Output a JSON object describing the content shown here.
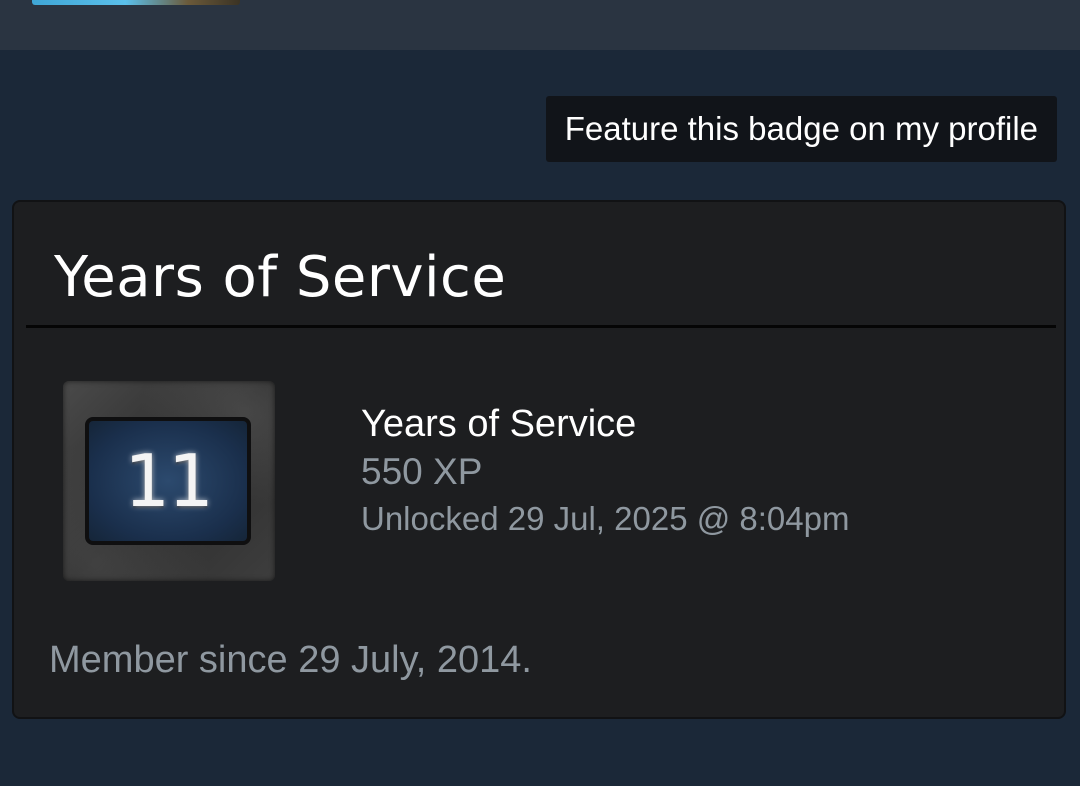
{
  "header": {
    "logo_icon": "steam-level-badge-graphic"
  },
  "actions": {
    "feature_badge_label": "Feature this badge on my profile"
  },
  "badge_panel": {
    "title": "Years of Service",
    "badge": {
      "icon": "years-of-service-badge-icon",
      "number": "11",
      "name": "Years of Service",
      "xp": "550 XP",
      "unlocked": "Unlocked 29 Jul, 2025 @ 8:04pm"
    },
    "description": "Member since 29 July, 2014."
  },
  "colors": {
    "page_background": "#1b2838",
    "topbar_background": "#2a3441",
    "panel_background": "#1d1e20",
    "button_background": "#111419",
    "secondary_text": "#8f98a0",
    "primary_text": "#ffffff"
  }
}
